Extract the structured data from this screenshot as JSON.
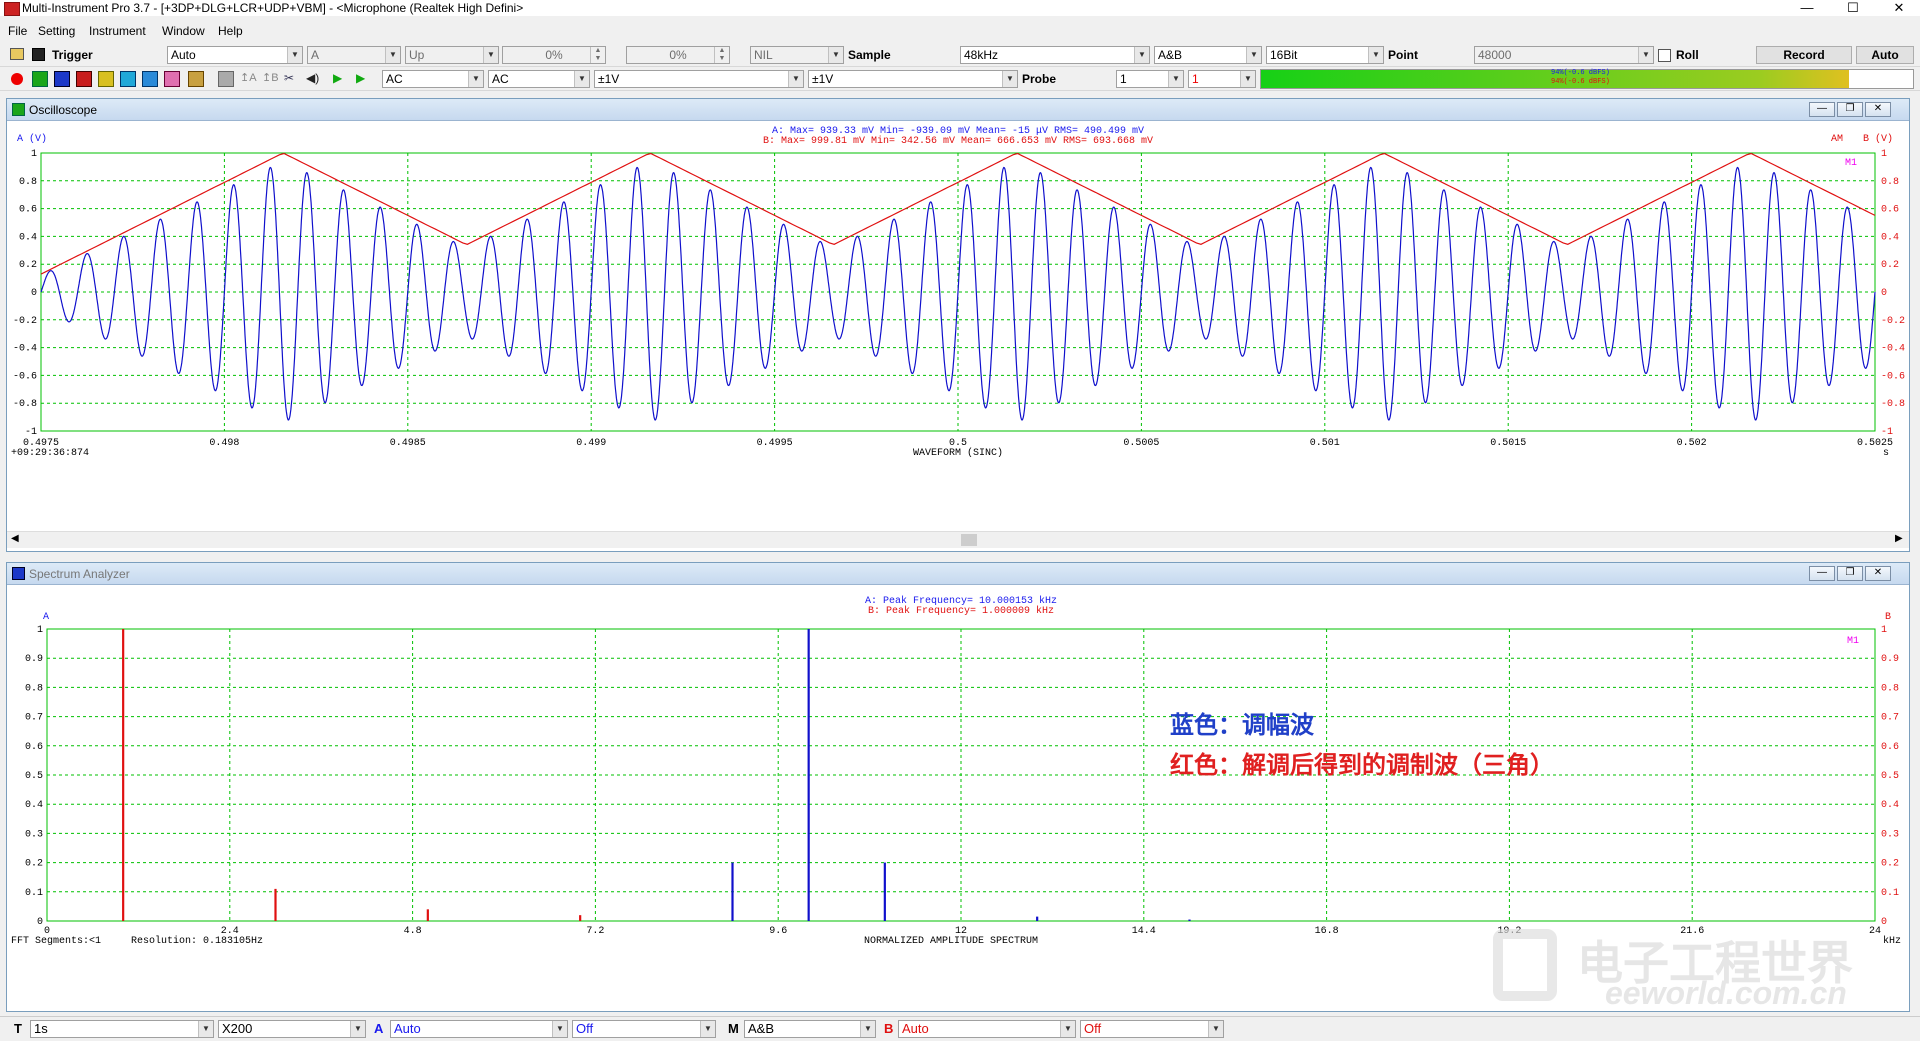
{
  "window": {
    "title": "Multi-Instrument Pro 3.7  -  [+3DP+DLG+LCR+UDP+VBM]  -  <Microphone (Realtek High Defini>"
  },
  "menu": [
    "File",
    "Setting",
    "Instrument",
    "Window",
    "Help"
  ],
  "toolbar1": {
    "trigger_label": "Trigger",
    "trigger_mode": "Auto",
    "trigger_channel": "A",
    "trigger_edge": "Up",
    "pct1": "0%",
    "pct2": "0%",
    "nil": "NIL",
    "sample_label": "Sample",
    "sample_rate": "48kHz",
    "channels": "A&B",
    "bits": "16Bit",
    "point_label": "Point",
    "points": "48000",
    "roll_label": "Roll",
    "record_button": "Record",
    "auto_button": "Auto"
  },
  "toolbar2": {
    "coupling_a": "AC",
    "coupling_b": "AC",
    "range_a": "±1V",
    "range_b": "±1V",
    "probe_label": "Probe",
    "probe_a": "1",
    "probe_b": "1",
    "level_a": "94%(-0.6 dBFS)",
    "level_b": "94%(-0.6 dBFS)"
  },
  "oscilloscope": {
    "title": "Oscilloscope",
    "axis_left": "A (V)",
    "axis_right": "B (V)",
    "right_tag": "AM",
    "marker": "M1",
    "stats_a": "A: Max=   939.33 mV  Min= -939.09 mV  Mean=     -15 μV  RMS=  490.499 mV",
    "stats_b": "B: Max=   999.81 mV  Min=   342.56 mV  Mean=  666.653 mV  RMS=  693.668 mV",
    "y_ticks": [
      "1",
      "0.8",
      "0.6",
      "0.4",
      "0.2",
      "0",
      "-0.2",
      "-0.4",
      "-0.6",
      "-0.8",
      "-1"
    ],
    "x_ticks": [
      "0.4975",
      "0.498",
      "0.4985",
      "0.499",
      "0.4995",
      "0.5",
      "0.5005",
      "0.501",
      "0.5015",
      "0.502",
      "0.5025"
    ],
    "x_unit": "s",
    "timestamp": "+09:29:36:874",
    "bottom_label": "WAVEFORM (SINC)"
  },
  "spectrum": {
    "title": "Spectrum Analyzer",
    "axis_left": "A",
    "axis_right": "B",
    "marker": "M1",
    "peak_a": "A: Peak Frequency= 10.000153 kHz",
    "peak_b": "B: Peak Frequency=  1.000009 kHz",
    "y_ticks": [
      "1",
      "0.9",
      "0.8",
      "0.7",
      "0.6",
      "0.5",
      "0.4",
      "0.3",
      "0.2",
      "0.1",
      "0"
    ],
    "x_ticks": [
      "0",
      "2.4",
      "4.8",
      "7.2",
      "9.6",
      "12",
      "14.4",
      "16.8",
      "19.2",
      "21.6",
      "24"
    ],
    "x_unit": "kHz",
    "fft_segments": "FFT Segments:<1",
    "resolution": "Resolution: 0.183105Hz",
    "bottom_label": "NORMALIZED AMPLITUDE SPECTRUM",
    "annotation_blue": "蓝色：调幅波",
    "annotation_red": "红色：解调后得到的调制波（三角）"
  },
  "statusbar": {
    "t_label": "T",
    "time_value": "1s",
    "zoom_value": "X200",
    "a_label": "A",
    "a_value": "Auto",
    "off1": "Off",
    "m_label": "M",
    "m_value": "A&B",
    "b_label": "B",
    "b_value": "Auto",
    "off2": "Off"
  },
  "watermark": {
    "line1": "电子工程世界",
    "line2": "eeworld.com.cn"
  },
  "colors": {
    "channel_a": "#1010cc",
    "channel_b": "#e01010",
    "grid": "#00c000",
    "accent": "#f000f0"
  },
  "chart_data": [
    {
      "type": "line",
      "x_range": [
        0.4975,
        0.5025
      ],
      "ylim": [
        -1,
        1
      ],
      "grid": true,
      "series": [
        {
          "name": "A",
          "color": "#1010cc",
          "kind": "AM carrier",
          "carrier_khz": 10,
          "envelope": "triangle",
          "max": 0.939,
          "min": -0.939
        },
        {
          "name": "B",
          "color": "#e01010",
          "kind": "triangle",
          "freq_khz": 1,
          "max": 1.0,
          "min": 0.34
        }
      ],
      "envelope_peaks_s": [
        0.49816,
        0.49916,
        0.50016,
        0.50116,
        0.50216
      ],
      "envelope_troughs_s": [
        0.49766,
        0.49866,
        0.49966,
        0.50066,
        0.50166,
        0.50266
      ]
    },
    {
      "type": "bar",
      "x_range": [
        0,
        24
      ],
      "ylim": [
        0,
        1
      ],
      "grid": true,
      "series": [
        {
          "name": "A",
          "color": "#1010cc",
          "freq_khz": [
            9.0,
            10.0,
            11.0,
            13.0,
            15.0
          ],
          "values": [
            0.2,
            1.0,
            0.2,
            0.015,
            0.005
          ]
        },
        {
          "name": "B",
          "color": "#e01010",
          "freq_khz": [
            1.0,
            3.0,
            5.0,
            7.0
          ],
          "values": [
            1.0,
            0.11,
            0.04,
            0.02
          ]
        }
      ]
    }
  ]
}
